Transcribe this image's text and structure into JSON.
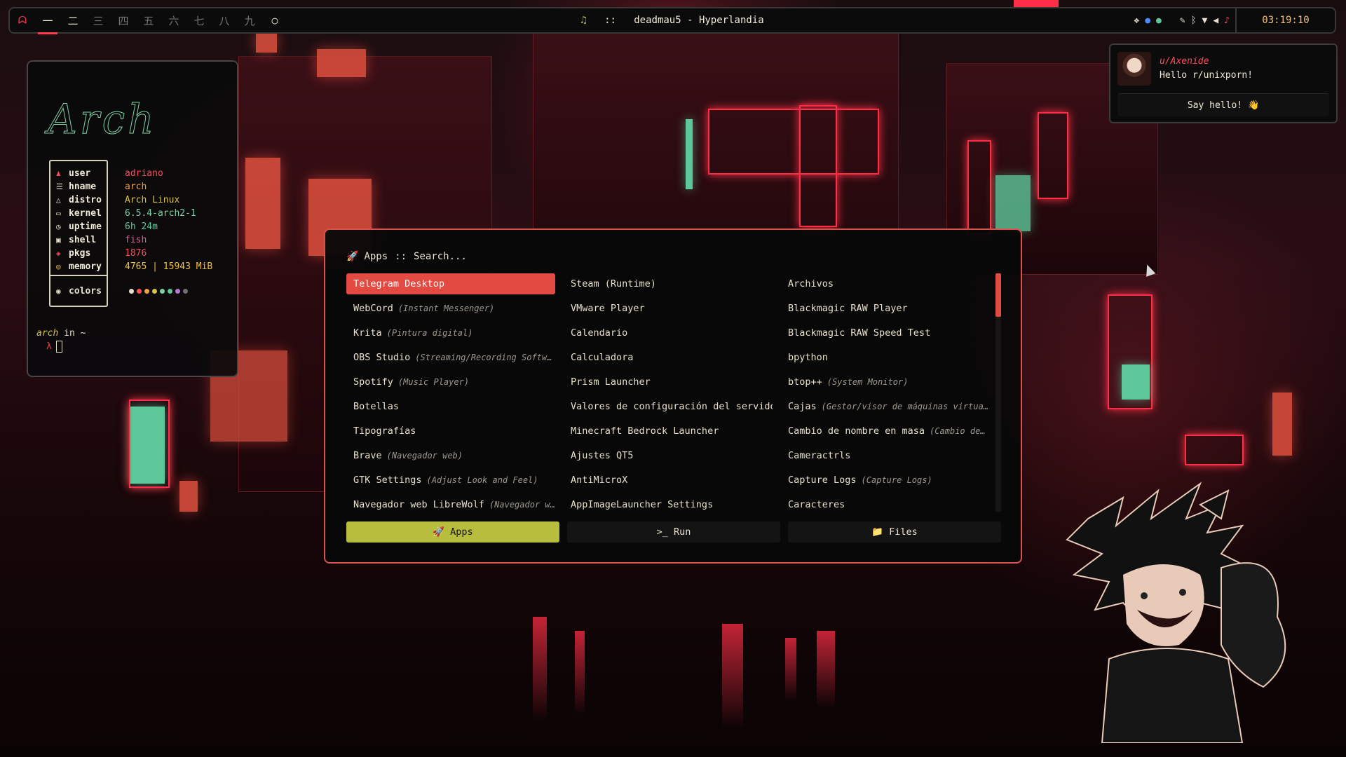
{
  "topbar": {
    "workspaces": [
      "一",
      "二",
      "三",
      "四",
      "五",
      "六",
      "七",
      "八",
      "九"
    ],
    "active_workspace": "一",
    "now_playing_icon": "♫",
    "title_separator": "::",
    "window_title": "deadmau5 - Hyperlandia",
    "clock": "03:19:10",
    "tray_icons": [
      "dropbox-icon",
      "chrome-icon",
      "spotify-icon",
      "pen-icon",
      "bluetooth-icon",
      "wifi-icon",
      "volume-icon",
      "bell-icon"
    ]
  },
  "fetch": {
    "logo_text": "Arch",
    "rows": [
      {
        "key": "user",
        "value": "adriano",
        "color": "#ff4a5a"
      },
      {
        "key": "hname",
        "value": "arch",
        "color": "#f0a040"
      },
      {
        "key": "distro",
        "value": "Arch Linux",
        "color": "#d9c24a"
      },
      {
        "key": "kernel",
        "value": "6.5.4-arch2-1",
        "color": "#7ed1a6"
      },
      {
        "key": "uptime",
        "value": "6h 24m",
        "color": "#5ec79a"
      },
      {
        "key": "shell",
        "value": "fish",
        "color": "#e05a9a"
      },
      {
        "key": "pkgs",
        "value": "1876",
        "color": "#ff4a5a"
      },
      {
        "key": "memory",
        "value": "4765 | 15943 MiB",
        "color": "#f0c040"
      }
    ],
    "colors_label": "colors",
    "palette": [
      "#e8e0cc",
      "#ff4a5a",
      "#f0a040",
      "#d9c24a",
      "#7ed1a6",
      "#5ec79a",
      "#b07ad0",
      "#707070"
    ],
    "prompt_user": "arch",
    "prompt_in": "in",
    "prompt_dir": "~",
    "prompt_symbol": "λ"
  },
  "notification": {
    "user": "u/Axenide",
    "message": "Hello r/unixporn!",
    "action": "Say hello! 👋"
  },
  "launcher": {
    "mode_icon": "🚀",
    "mode_label": "Apps",
    "separator": "::",
    "search_placeholder": "Search...",
    "items": [
      {
        "name": "Telegram Desktop",
        "desc": ""
      },
      {
        "name": "Steam (Runtime)",
        "desc": ""
      },
      {
        "name": "Archivos",
        "desc": ""
      },
      {
        "name": "WebCord",
        "desc": "(Instant Messenger)"
      },
      {
        "name": "VMware Player",
        "desc": ""
      },
      {
        "name": "Blackmagic RAW Player",
        "desc": ""
      },
      {
        "name": "Krita",
        "desc": "(Pintura digital)"
      },
      {
        "name": "Calendario",
        "desc": ""
      },
      {
        "name": "Blackmagic RAW Speed Test",
        "desc": ""
      },
      {
        "name": "OBS Studio",
        "desc": "(Streaming/Recording Software)"
      },
      {
        "name": "Calculadora",
        "desc": ""
      },
      {
        "name": "bpython",
        "desc": ""
      },
      {
        "name": "Spotify",
        "desc": "(Music Player)"
      },
      {
        "name": "Prism Launcher",
        "desc": ""
      },
      {
        "name": "btop++",
        "desc": "(System Monitor)"
      },
      {
        "name": "Botellas",
        "desc": ""
      },
      {
        "name": "Valores de configuración del servidor ...",
        "desc": ""
      },
      {
        "name": "Cajas",
        "desc": "(Gestor/visor de máquinas virtuales)"
      },
      {
        "name": "Tipografías",
        "desc": ""
      },
      {
        "name": "Minecraft Bedrock Launcher",
        "desc": ""
      },
      {
        "name": "Cambio de nombre en masa",
        "desc": "(Cambio de nombr..."
      },
      {
        "name": "Brave",
        "desc": "(Navegador web)"
      },
      {
        "name": "Ajustes QT5",
        "desc": ""
      },
      {
        "name": "Cameractrls",
        "desc": ""
      },
      {
        "name": "GTK Settings",
        "desc": "(Adjust Look and Feel)"
      },
      {
        "name": "AntiMicroX",
        "desc": ""
      },
      {
        "name": "Capture Logs",
        "desc": "(Capture Logs)"
      },
      {
        "name": "Navegador web LibreWolf",
        "desc": "(Navegador web)"
      },
      {
        "name": "AppImageLauncher Settings",
        "desc": ""
      },
      {
        "name": "Caracteres",
        "desc": ""
      }
    ],
    "selected_index": 0,
    "tabs": [
      {
        "label": "Apps",
        "icon": "🚀",
        "active": true
      },
      {
        "label": "Run",
        "icon": ">_",
        "active": false
      },
      {
        "label": "Files",
        "icon": "📁",
        "active": false
      }
    ]
  },
  "colors": {
    "accent": "#e24a42",
    "active_tab": "#b7bd3d"
  }
}
